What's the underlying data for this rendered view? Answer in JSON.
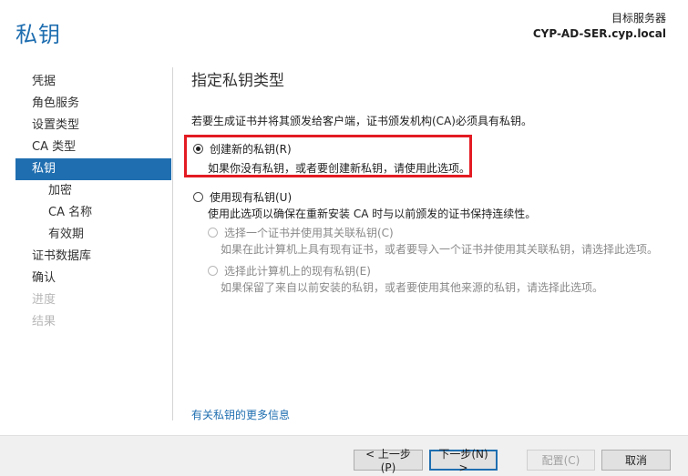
{
  "header": {
    "title": "私钥",
    "server_label": "目标服务器",
    "server_name": "CYP-AD-SER.cyp.local"
  },
  "sidebar": {
    "items": [
      {
        "label": "凭据",
        "state": "normal",
        "sub": false
      },
      {
        "label": "角色服务",
        "state": "normal",
        "sub": false
      },
      {
        "label": "设置类型",
        "state": "normal",
        "sub": false
      },
      {
        "label": "CA 类型",
        "state": "normal",
        "sub": false
      },
      {
        "label": "私钥",
        "state": "active",
        "sub": false
      },
      {
        "label": "加密",
        "state": "normal",
        "sub": true
      },
      {
        "label": "CA 名称",
        "state": "normal",
        "sub": true
      },
      {
        "label": "有效期",
        "state": "normal",
        "sub": true
      },
      {
        "label": "证书数据库",
        "state": "normal",
        "sub": false
      },
      {
        "label": "确认",
        "state": "normal",
        "sub": false
      },
      {
        "label": "进度",
        "state": "disabled",
        "sub": false
      },
      {
        "label": "结果",
        "state": "disabled",
        "sub": false
      }
    ]
  },
  "main": {
    "heading": "指定私钥类型",
    "intro": "若要生成证书并将其颁发给客户端，证书颁发机构(CA)必须具有私钥。",
    "option_new": {
      "label": "创建新的私钥(R)",
      "desc": "如果你没有私钥，或者要创建新私钥，请使用此选项。",
      "checked": true
    },
    "option_existing": {
      "label": "使用现有私钥(U)",
      "desc": "使用此选项以确保在重新安装 CA 时与以前颁发的证书保持连续性。",
      "checked": false
    },
    "sub_option_cert": {
      "label": "选择一个证书并使用其关联私钥(C)",
      "desc": "如果在此计算机上具有现有证书，或者要导入一个证书并使用其关联私钥，请选择此选项。"
    },
    "sub_option_existing_key": {
      "label": "选择此计算机上的现有私钥(E)",
      "desc": "如果保留了来自以前安装的私钥，或者要使用其他来源的私钥，请选择此选项。"
    },
    "more_link": "有关私钥的更多信息"
  },
  "footer": {
    "prev": "< 上一步(P)",
    "next": "下一步(N) >",
    "configure": "配置(C)",
    "cancel": "取消"
  },
  "colors": {
    "accent": "#1f6eb0",
    "highlight": "#e31b23"
  }
}
